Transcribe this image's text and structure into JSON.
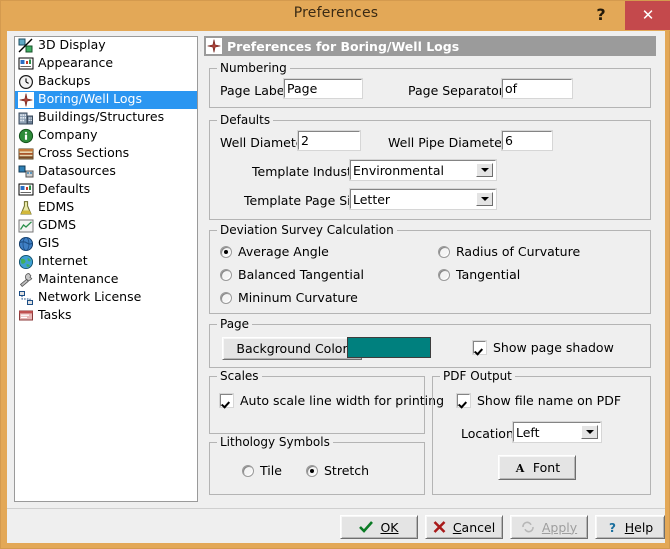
{
  "window": {
    "title": "Preferences",
    "help_glyph": "?",
    "close_glyph": "✕"
  },
  "sidebar": {
    "items": [
      {
        "label": "3D Display",
        "icon": "3d-display-icon",
        "selected": false
      },
      {
        "label": "Appearance",
        "icon": "appearance-icon",
        "selected": false
      },
      {
        "label": "Backups",
        "icon": "clock-icon",
        "selected": false
      },
      {
        "label": "Boring/Well Logs",
        "icon": "boring-well-logs-icon",
        "selected": true
      },
      {
        "label": "Buildings/Structures",
        "icon": "buildings-icon",
        "selected": false
      },
      {
        "label": "Company",
        "icon": "info-icon",
        "selected": false
      },
      {
        "label": "Cross Sections",
        "icon": "cross-sections-icon",
        "selected": false
      },
      {
        "label": "Datasources",
        "icon": "datasources-icon",
        "selected": false
      },
      {
        "label": "Defaults",
        "icon": "defaults-icon",
        "selected": false
      },
      {
        "label": "EDMS",
        "icon": "flask-icon",
        "selected": false
      },
      {
        "label": "GDMS",
        "icon": "chart-icon",
        "selected": false
      },
      {
        "label": "GIS",
        "icon": "globe-blue-icon",
        "selected": false
      },
      {
        "label": "Internet",
        "icon": "globe-green-icon",
        "selected": false
      },
      {
        "label": "Maintenance",
        "icon": "wrench-icon",
        "selected": false
      },
      {
        "label": "Network License",
        "icon": "network-icon",
        "selected": false
      },
      {
        "label": "Tasks",
        "icon": "tasks-icon",
        "selected": false
      }
    ]
  },
  "panel": {
    "header": "Preferences for Boring/Well Logs",
    "header_icon": "boring-well-logs-icon"
  },
  "numbering": {
    "title": "Numbering",
    "page_label_label": "Page Label:",
    "page_label_value": "Page",
    "page_separator_label": "Page Separator:",
    "page_separator_value": "of"
  },
  "defaults": {
    "title": "Defaults",
    "well_diameter_label": "Well Diameter:",
    "well_diameter_value": "2",
    "well_pipe_diameter_label": "Well Pipe Diameter:",
    "well_pipe_diameter_value": "6",
    "template_industry_label": "Template Industry:",
    "template_industry_value": "Environmental",
    "template_page_size_label": "Template Page Size:",
    "template_page_size_value": "Letter"
  },
  "deviation": {
    "title": "Deviation Survey Calculation",
    "options": [
      {
        "label": "Average Angle",
        "selected": true
      },
      {
        "label": "Radius of Curvature",
        "selected": false
      },
      {
        "label": "Balanced Tangential",
        "selected": false
      },
      {
        "label": "Tangential",
        "selected": false
      },
      {
        "label": "Mininum Curvature",
        "selected": false
      }
    ]
  },
  "page": {
    "title": "Page",
    "background_color_button": "Background Color",
    "background_color_value": "#00807e",
    "show_page_shadow_label": "Show page shadow",
    "show_page_shadow_checked": true
  },
  "scales": {
    "title": "Scales",
    "auto_scale_label": "Auto scale line width for printing",
    "auto_scale_checked": true
  },
  "pdf_output": {
    "title": "PDF Output",
    "show_file_name_label": "Show file name on PDF",
    "show_file_name_checked": true,
    "location_label": "Location",
    "location_value": "Left",
    "font_button": "Font",
    "font_icon": "font-A-icon"
  },
  "lithology": {
    "title": "Lithology Symbols",
    "options": [
      {
        "label": "Tile",
        "selected": false
      },
      {
        "label": "Stretch",
        "selected": true
      }
    ]
  },
  "footer": {
    "ok": "OK",
    "cancel": "Cancel",
    "apply": "Apply",
    "help": "Help",
    "apply_disabled": true
  }
}
